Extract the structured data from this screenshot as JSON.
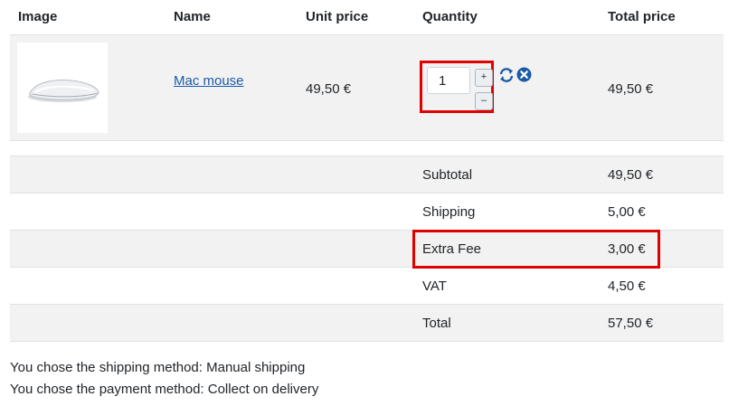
{
  "table": {
    "headers": {
      "image": "Image",
      "name": "Name",
      "unit_price": "Unit price",
      "quantity": "Quantity",
      "total_price": "Total price"
    },
    "item": {
      "name": "Mac mouse",
      "unit_price": "49,50 €",
      "quantity": "1",
      "total_price": "49,50 €",
      "plus_label": "+",
      "minus_label": "–",
      "image_icon": "mouse-product-image",
      "refresh_icon": "refresh-icon",
      "remove_icon": "remove-circle-x-icon"
    }
  },
  "summary": [
    {
      "label": "Subtotal",
      "value": "49,50 €"
    },
    {
      "label": "Shipping",
      "value": "5,00 €"
    },
    {
      "label": "Extra Fee",
      "value": "3,00 €"
    },
    {
      "label": "VAT",
      "value": "4,50 €"
    },
    {
      "label": "Total",
      "value": "57,50 €"
    }
  ],
  "info": {
    "shipping": "You chose the shipping method: Manual shipping",
    "payment": "You chose the payment method: Collect on delivery"
  },
  "colors": {
    "link": "#1a5ba8",
    "highlight": "#e00000",
    "row_shade": "#f2f2f2",
    "icon_blue": "#1a5ba8"
  }
}
